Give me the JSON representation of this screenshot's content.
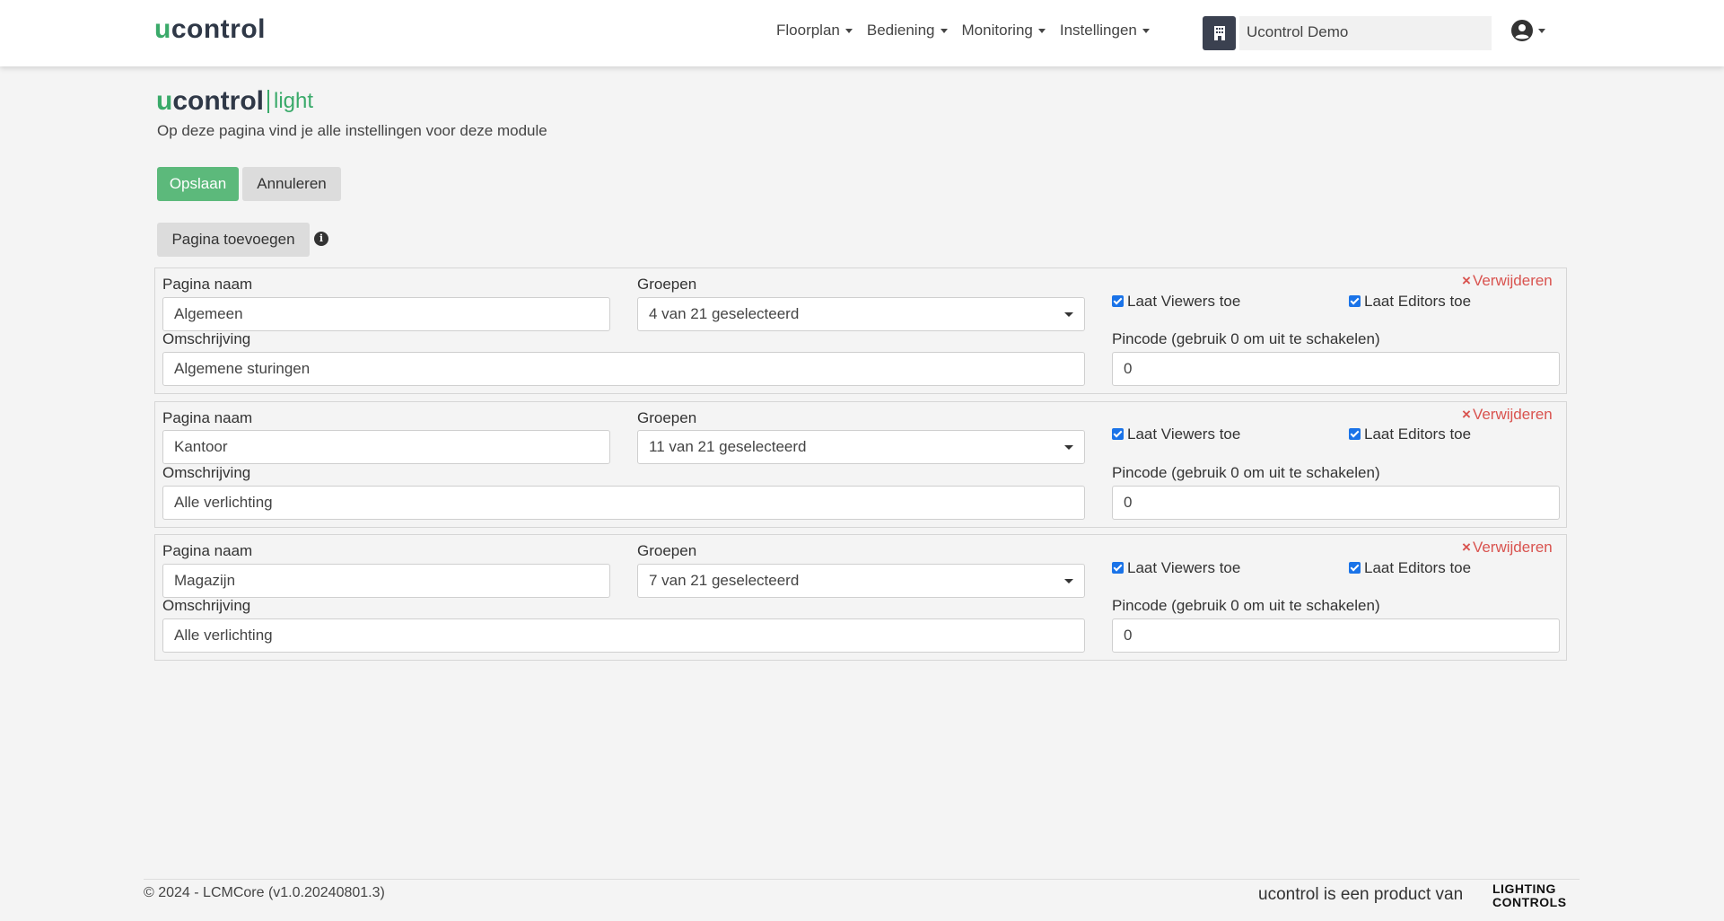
{
  "navbar": {
    "brand_u": "u",
    "brand_rest": "control",
    "menu": [
      {
        "label": "Floorplan"
      },
      {
        "label": "Bediening"
      },
      {
        "label": "Monitoring"
      },
      {
        "label": "Instellingen"
      }
    ],
    "site_name": "Ucontrol Demo",
    "site_icon": "building-icon",
    "user_icon": "user-circle-icon"
  },
  "module": {
    "logo_u": "u",
    "logo_rest": "control",
    "logo_suffix": "light",
    "subtitle": "Op deze pagina vind je alle instellingen voor deze module"
  },
  "actions": {
    "save": "Opslaan",
    "cancel": "Annuleren",
    "add_page": "Pagina toevoegen",
    "info_icon": "i"
  },
  "labels": {
    "page_name": "Pagina naam",
    "groups": "Groepen",
    "description": "Omschrijving",
    "allow_viewers": "Laat Viewers toe",
    "allow_editors": "Laat Editors toe",
    "pincode": "Pincode (gebruik 0 om uit te schakelen)",
    "remove": "Verwijderen",
    "remove_x": "×"
  },
  "pages": [
    {
      "name": "Algemeen",
      "groups": "4 van 21 geselecteerd",
      "description": "Algemene sturingen",
      "allow_viewers": true,
      "allow_editors": true,
      "pincode": "0"
    },
    {
      "name": "Kantoor",
      "groups": "11 van 21 geselecteerd",
      "description": "Alle verlichting",
      "allow_viewers": true,
      "allow_editors": true,
      "pincode": "0"
    },
    {
      "name": "Magazijn",
      "groups": "7 van 21 geselecteerd",
      "description": "Alle verlichting",
      "allow_viewers": true,
      "allow_editors": true,
      "pincode": "0"
    }
  ],
  "footer": {
    "copyright": "© 2024 - LCMCore (v1.0.20240801.3)",
    "product_text": "ucontrol is een product van",
    "partner_line1": "LIGHTING",
    "partner_line2": "CONTROLS"
  },
  "colors": {
    "accent_green": "#3aaa6a",
    "save_button": "#5cb97b",
    "remove_red": "#d9534f",
    "checkbox_blue": "#1a73e8"
  }
}
